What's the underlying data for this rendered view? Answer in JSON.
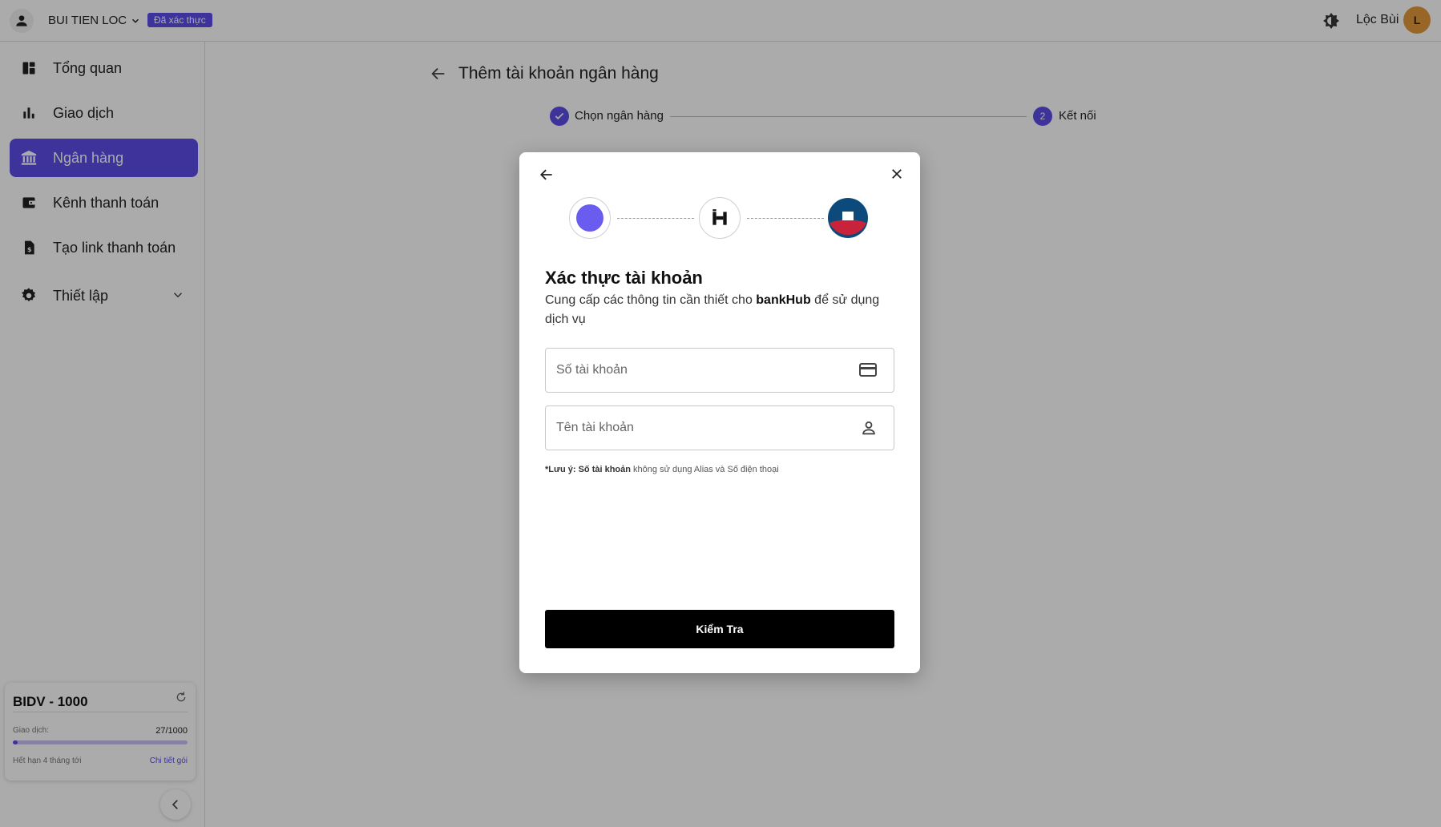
{
  "topbar": {
    "account_name": "BUI TIEN LOC",
    "verified_badge": "Đã xác thực",
    "user_name": "Lộc Bùi",
    "avatar_initial": "L"
  },
  "sidebar": {
    "items": [
      {
        "label": "Tổng quan",
        "icon": "dashboard-icon"
      },
      {
        "label": "Giao dịch",
        "icon": "bar-chart-icon"
      },
      {
        "label": "Ngân hàng",
        "icon": "bank-icon",
        "active": true
      },
      {
        "label": "Kênh thanh toán",
        "icon": "wallet-icon"
      },
      {
        "label": "Tạo link thanh toán",
        "icon": "invoice-icon"
      },
      {
        "label": "Thiết lập",
        "icon": "gear-icon"
      }
    ],
    "plan": {
      "title": "BIDV - 1000",
      "usage_label": "Giao dịch:",
      "usage_value": "27/1000",
      "usage_fraction": 0.027,
      "expiry": "Hết hạn 4 tháng tới",
      "details_link": "Chi tiết gói"
    }
  },
  "main": {
    "title": "Thêm tài khoản ngân hàng",
    "steps": [
      {
        "label": "Chọn ngân hàng",
        "state": "done"
      },
      {
        "label": "Kết nối",
        "number": "2",
        "state": "active"
      }
    ]
  },
  "modal": {
    "heading": "Xác thực tài khoản",
    "desc_prefix": "Cung cấp các thông tin cần thiết cho ",
    "desc_brand": "bankHub",
    "desc_suffix": " để sử dụng dịch vụ",
    "account_number_placeholder": "Số tài khoản",
    "account_name_placeholder": "Tên tài khoản",
    "note_prefix": "*Lưu ý: ",
    "note_bold": "Số tài khoản",
    "note_suffix": " không sử dụng Alias và Số điện thoại",
    "submit_label": "Kiểm Tra"
  },
  "colors": {
    "accent": "#5b4ce8",
    "overlay": "rgba(0,0,0,0.33)",
    "bank_logo_blue": "#0b4a7a",
    "bank_logo_red": "#c8233b"
  }
}
